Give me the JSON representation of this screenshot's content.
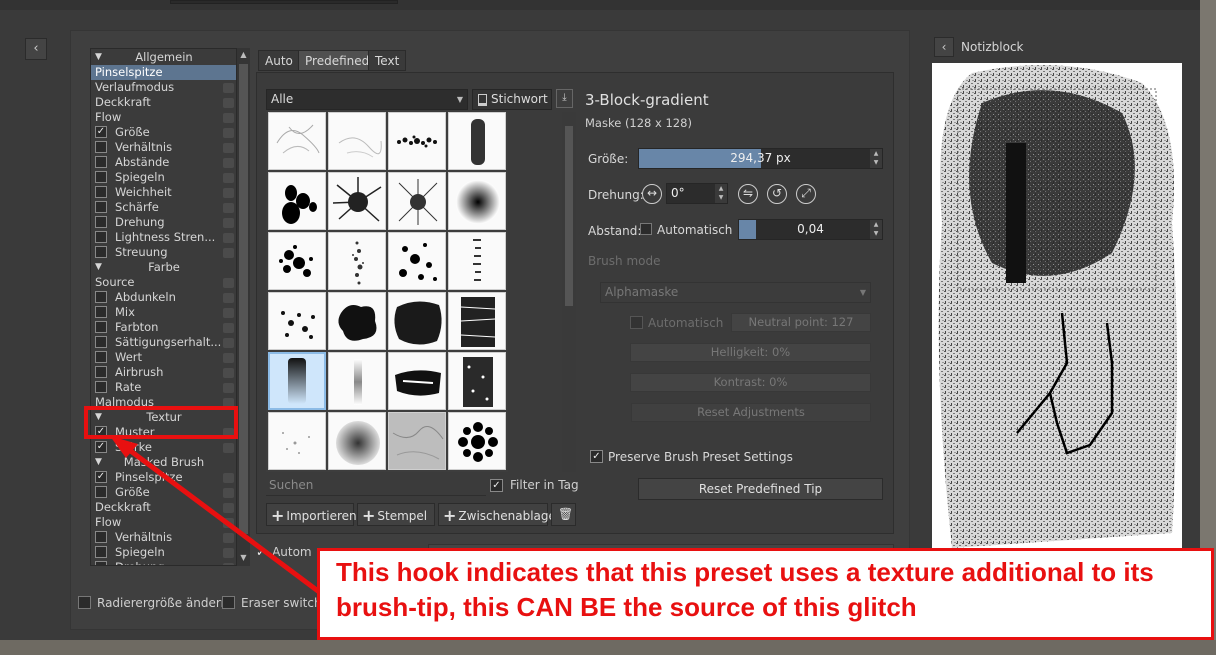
{
  "left_list": {
    "items": [
      {
        "label": "Allgemein",
        "kind": "header"
      },
      {
        "label": "Pinselspitze",
        "kind": "plain",
        "selected": true
      },
      {
        "label": "Verlaufmodus",
        "kind": "plain"
      },
      {
        "label": "Deckkraft",
        "kind": "plain"
      },
      {
        "label": "Flow",
        "kind": "plain"
      },
      {
        "label": "Größe",
        "kind": "check",
        "checked": true
      },
      {
        "label": "Verhältnis",
        "kind": "check"
      },
      {
        "label": "Abstände",
        "kind": "check"
      },
      {
        "label": "Spiegeln",
        "kind": "check"
      },
      {
        "label": "Weichheit",
        "kind": "check"
      },
      {
        "label": "Schärfe",
        "kind": "check"
      },
      {
        "label": "Drehung",
        "kind": "check"
      },
      {
        "label": "Lightness Stren...",
        "kind": "check"
      },
      {
        "label": "Streuung",
        "kind": "check"
      },
      {
        "label": "Farbe",
        "kind": "header"
      },
      {
        "label": "Source",
        "kind": "plain"
      },
      {
        "label": "Abdunkeln",
        "kind": "check"
      },
      {
        "label": "Mix",
        "kind": "check"
      },
      {
        "label": "Farbton",
        "kind": "check"
      },
      {
        "label": "Sättigungserhalt...",
        "kind": "check"
      },
      {
        "label": "Wert",
        "kind": "check"
      },
      {
        "label": "Airbrush",
        "kind": "check"
      },
      {
        "label": "Rate",
        "kind": "check"
      },
      {
        "label": "Malmodus",
        "kind": "plain"
      },
      {
        "label": "Textur",
        "kind": "header"
      },
      {
        "label": "Muster",
        "kind": "check",
        "checked": true
      },
      {
        "label": "Stärke",
        "kind": "check",
        "checked": true
      },
      {
        "label": "Masked Brush",
        "kind": "header"
      },
      {
        "label": "Pinselspitze",
        "kind": "check",
        "checked": true
      },
      {
        "label": "Größe",
        "kind": "check"
      },
      {
        "label": "Deckkraft",
        "kind": "plain"
      },
      {
        "label": "Flow",
        "kind": "plain"
      },
      {
        "label": "Verhältnis",
        "kind": "check"
      },
      {
        "label": "Spiegeln",
        "kind": "check"
      },
      {
        "label": "Drehung",
        "kind": "check"
      }
    ]
  },
  "tabs": {
    "auto": "Auto",
    "predefined": "Predefined",
    "text": "Text"
  },
  "filter_combo": {
    "value": "Alle"
  },
  "tag_button": {
    "label": "Stichwort"
  },
  "search": {
    "placeholder": "Suchen"
  },
  "filter_in_tag": {
    "label": "Filter in Tag",
    "checked": true
  },
  "buttons": {
    "import": "Importieren",
    "stamp": "Stempel",
    "clipboard": "Zwischenablage"
  },
  "brush": {
    "name": "3-Block-gradient",
    "mask": "Maske (128 x 128)"
  },
  "size": {
    "label": "Größe:",
    "value": "294,37 px",
    "fraction": 0.5
  },
  "rotation": {
    "label": "Drehung:",
    "value": "0°"
  },
  "spacing": {
    "label": "Abstand:",
    "auto_label": "Automatisch",
    "value": "0,04",
    "fraction": 0.12
  },
  "brush_mode": {
    "label": "Brush mode",
    "select": "Alphamaske",
    "auto_label": "Automatisch",
    "neutral": "Neutral point: 127",
    "brightness": "Helligkeit: 0%",
    "contrast": "Kontrast: 0%",
    "reset": "Reset Adjustments"
  },
  "preserve": {
    "label": "Preserve Brush Preset Settings",
    "checked": true
  },
  "reset_tip": {
    "label": "Reset Predefined Tip"
  },
  "scratchpad": {
    "title": "Notizblock"
  },
  "bottom": {
    "eraser_size": "Radierergröße ändern",
    "eraser_switch": "Eraser switch o",
    "auto": "Autom"
  },
  "annotation": {
    "text": "This hook indicates that this preset uses a texture additional to its brush-tip, this CAN BE the source of this glitch",
    "color": "#e81010"
  }
}
